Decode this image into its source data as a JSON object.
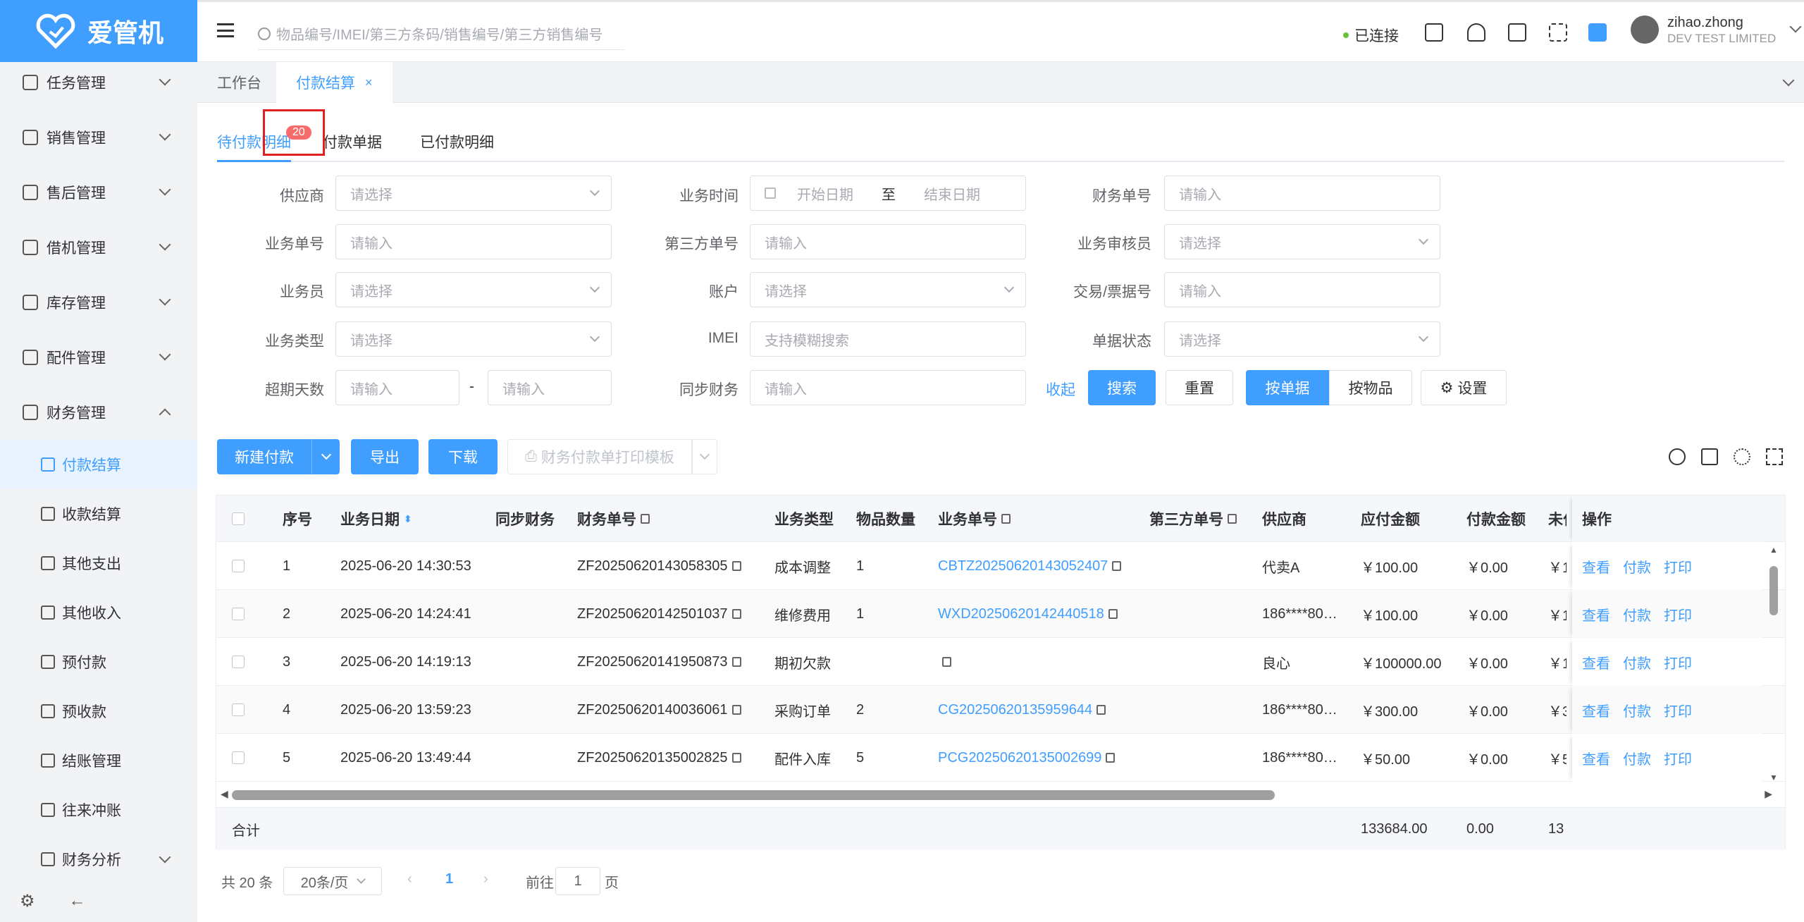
{
  "app": {
    "name": "爱管机"
  },
  "sidebar": {
    "items": [
      {
        "label": "任务管理",
        "icon": "task-icon"
      },
      {
        "label": "销售管理",
        "icon": "sales-icon"
      },
      {
        "label": "售后管理",
        "icon": "aftersale-icon"
      },
      {
        "label": "借机管理",
        "icon": "phone-icon"
      },
      {
        "label": "库存管理",
        "icon": "warehouse-icon"
      },
      {
        "label": "配件管理",
        "icon": "parts-icon"
      },
      {
        "label": "财务管理",
        "icon": "finance-icon"
      }
    ],
    "sub_items": [
      {
        "label": "付款结算",
        "icon": "payment-icon"
      },
      {
        "label": "收款结算",
        "icon": "receipt-icon"
      },
      {
        "label": "其他支出",
        "icon": "expense-icon"
      },
      {
        "label": "其他收入",
        "icon": "income-icon"
      },
      {
        "label": "预付款",
        "icon": "prepay-icon"
      },
      {
        "label": "预收款",
        "icon": "prereceive-icon"
      },
      {
        "label": "结账管理",
        "icon": "settle-icon"
      },
      {
        "label": "往来冲账",
        "icon": "offset-icon"
      }
    ],
    "analysis": "财务分析"
  },
  "topbar": {
    "search_placeholder": "物品编号/IMEI/第三方条码/销售编号/第三方销售编号",
    "status": "已连接",
    "user_name": "zihao.zhong",
    "company": "DEV TEST LIMITED"
  },
  "tabs": [
    {
      "label": "工作台"
    },
    {
      "label": "付款结算",
      "close": "×"
    }
  ],
  "subtabs": [
    {
      "label": "待付款明细"
    },
    {
      "label": "付款单据"
    },
    {
      "label": "已付款明细"
    }
  ],
  "badge": "20",
  "filters": {
    "supplier": {
      "label": "供应商",
      "placeholder": "请选择"
    },
    "biz_time": {
      "label": "业务时间",
      "start": "开始日期",
      "sep": "至",
      "end": "结束日期"
    },
    "fin_no": {
      "label": "财务单号",
      "placeholder": "请输入"
    },
    "biz_no": {
      "label": "业务单号",
      "placeholder": "请输入"
    },
    "third_no": {
      "label": "第三方单号",
      "placeholder": "请输入"
    },
    "auditor": {
      "label": "业务审核员",
      "placeholder": "请选择"
    },
    "salesman": {
      "label": "业务员",
      "placeholder": "请选择"
    },
    "account": {
      "label": "账户",
      "placeholder": "请选择"
    },
    "trade_no": {
      "label": "交易/票据号",
      "placeholder": "请输入"
    },
    "biz_type": {
      "label": "业务类型",
      "placeholder": "请选择"
    },
    "imei": {
      "label": "IMEI",
      "placeholder": "支持模糊搜索"
    },
    "doc_status": {
      "label": "单据状态",
      "placeholder": "请选择"
    },
    "overdue": {
      "label": "超期天数",
      "placeholder": "请输入",
      "sep": "-"
    },
    "sync": {
      "label": "同步财务",
      "placeholder": "请输入"
    }
  },
  "actions": {
    "collapse": "收起",
    "search": "搜索",
    "reset": "重置",
    "by_doc": "按单据",
    "by_item": "按物品",
    "settings": "设置"
  },
  "toolbar": {
    "new_payment": "新建付款",
    "export": "导出",
    "download": "下载",
    "print_template": "财务付款单打印模板"
  },
  "table": {
    "headers": [
      "序号",
      "业务日期",
      "同步财务",
      "财务单号",
      "业务类型",
      "物品数量",
      "业务单号",
      "第三方单号",
      "供应商",
      "应付金额",
      "付款金额",
      "未付",
      "操作"
    ],
    "rows": [
      {
        "no": "1",
        "date": "2025-06-20 14:30:53",
        "sync": "",
        "fin": "ZF20250620143058305",
        "type": "成本调整",
        "qty": "1",
        "biz": "CBTZ20250620143052407",
        "third": "",
        "supplier": "代卖A",
        "payable": "￥100.00",
        "paid": "￥0.00",
        "unpaid": "￥1"
      },
      {
        "no": "2",
        "date": "2025-06-20 14:24:41",
        "sync": "",
        "fin": "ZF20250620142501037",
        "type": "维修费用",
        "qty": "1",
        "biz": "WXD20250620142440518",
        "third": "",
        "supplier": "186****80…",
        "payable": "￥100.00",
        "paid": "￥0.00",
        "unpaid": "￥1"
      },
      {
        "no": "3",
        "date": "2025-06-20 14:19:13",
        "sync": "",
        "fin": "ZF20250620141950873",
        "type": "期初欠款",
        "qty": "",
        "biz": "",
        "third": "",
        "supplier": "良心",
        "payable": "￥100000.00",
        "paid": "￥0.00",
        "unpaid": "￥1"
      },
      {
        "no": "4",
        "date": "2025-06-20 13:59:23",
        "sync": "",
        "fin": "ZF20250620140036061",
        "type": "采购订单",
        "qty": "2",
        "biz": "CG20250620135959644",
        "third": "",
        "supplier": "186****80…",
        "payable": "￥300.00",
        "paid": "￥0.00",
        "unpaid": "￥3"
      },
      {
        "no": "5",
        "date": "2025-06-20 13:49:44",
        "sync": "",
        "fin": "ZF20250620135002825",
        "type": "配件入库",
        "qty": "5",
        "biz": "PCG20250620135002699",
        "third": "",
        "supplier": "186****80…",
        "payable": "￥50.00",
        "paid": "￥0.00",
        "unpaid": "￥5"
      }
    ],
    "ops": [
      "查看",
      "付款",
      "打印"
    ],
    "footer": {
      "label": "合计",
      "payable": "133684.00",
      "paid": "0.00",
      "unpaid": "13"
    }
  },
  "pagination": {
    "total": "共 20 条",
    "page_size": "20条/页",
    "current": "1",
    "goto": "前往",
    "goto_value": "1",
    "page_suffix": "页"
  }
}
